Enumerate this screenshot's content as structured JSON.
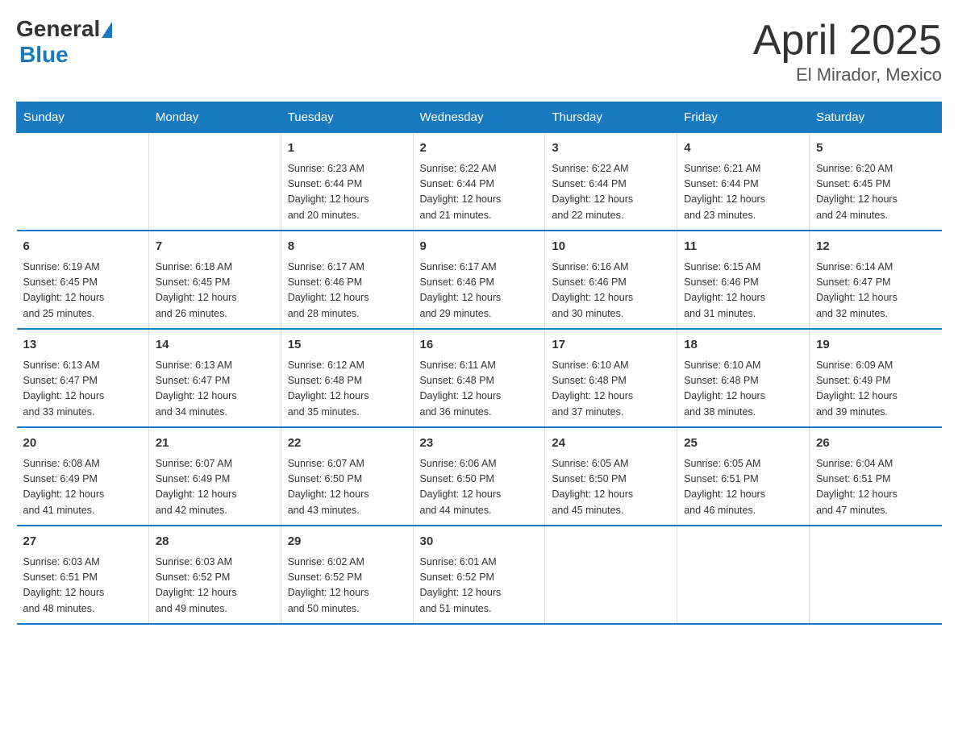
{
  "logo": {
    "general": "General",
    "blue": "Blue"
  },
  "title": "April 2025",
  "subtitle": "El Mirador, Mexico",
  "days_header": [
    "Sunday",
    "Monday",
    "Tuesday",
    "Wednesday",
    "Thursday",
    "Friday",
    "Saturday"
  ],
  "weeks": [
    [
      {
        "day": "",
        "info": ""
      },
      {
        "day": "",
        "info": ""
      },
      {
        "day": "1",
        "info": "Sunrise: 6:23 AM\nSunset: 6:44 PM\nDaylight: 12 hours\nand 20 minutes."
      },
      {
        "day": "2",
        "info": "Sunrise: 6:22 AM\nSunset: 6:44 PM\nDaylight: 12 hours\nand 21 minutes."
      },
      {
        "day": "3",
        "info": "Sunrise: 6:22 AM\nSunset: 6:44 PM\nDaylight: 12 hours\nand 22 minutes."
      },
      {
        "day": "4",
        "info": "Sunrise: 6:21 AM\nSunset: 6:44 PM\nDaylight: 12 hours\nand 23 minutes."
      },
      {
        "day": "5",
        "info": "Sunrise: 6:20 AM\nSunset: 6:45 PM\nDaylight: 12 hours\nand 24 minutes."
      }
    ],
    [
      {
        "day": "6",
        "info": "Sunrise: 6:19 AM\nSunset: 6:45 PM\nDaylight: 12 hours\nand 25 minutes."
      },
      {
        "day": "7",
        "info": "Sunrise: 6:18 AM\nSunset: 6:45 PM\nDaylight: 12 hours\nand 26 minutes."
      },
      {
        "day": "8",
        "info": "Sunrise: 6:17 AM\nSunset: 6:46 PM\nDaylight: 12 hours\nand 28 minutes."
      },
      {
        "day": "9",
        "info": "Sunrise: 6:17 AM\nSunset: 6:46 PM\nDaylight: 12 hours\nand 29 minutes."
      },
      {
        "day": "10",
        "info": "Sunrise: 6:16 AM\nSunset: 6:46 PM\nDaylight: 12 hours\nand 30 minutes."
      },
      {
        "day": "11",
        "info": "Sunrise: 6:15 AM\nSunset: 6:46 PM\nDaylight: 12 hours\nand 31 minutes."
      },
      {
        "day": "12",
        "info": "Sunrise: 6:14 AM\nSunset: 6:47 PM\nDaylight: 12 hours\nand 32 minutes."
      }
    ],
    [
      {
        "day": "13",
        "info": "Sunrise: 6:13 AM\nSunset: 6:47 PM\nDaylight: 12 hours\nand 33 minutes."
      },
      {
        "day": "14",
        "info": "Sunrise: 6:13 AM\nSunset: 6:47 PM\nDaylight: 12 hours\nand 34 minutes."
      },
      {
        "day": "15",
        "info": "Sunrise: 6:12 AM\nSunset: 6:48 PM\nDaylight: 12 hours\nand 35 minutes."
      },
      {
        "day": "16",
        "info": "Sunrise: 6:11 AM\nSunset: 6:48 PM\nDaylight: 12 hours\nand 36 minutes."
      },
      {
        "day": "17",
        "info": "Sunrise: 6:10 AM\nSunset: 6:48 PM\nDaylight: 12 hours\nand 37 minutes."
      },
      {
        "day": "18",
        "info": "Sunrise: 6:10 AM\nSunset: 6:48 PM\nDaylight: 12 hours\nand 38 minutes."
      },
      {
        "day": "19",
        "info": "Sunrise: 6:09 AM\nSunset: 6:49 PM\nDaylight: 12 hours\nand 39 minutes."
      }
    ],
    [
      {
        "day": "20",
        "info": "Sunrise: 6:08 AM\nSunset: 6:49 PM\nDaylight: 12 hours\nand 41 minutes."
      },
      {
        "day": "21",
        "info": "Sunrise: 6:07 AM\nSunset: 6:49 PM\nDaylight: 12 hours\nand 42 minutes."
      },
      {
        "day": "22",
        "info": "Sunrise: 6:07 AM\nSunset: 6:50 PM\nDaylight: 12 hours\nand 43 minutes."
      },
      {
        "day": "23",
        "info": "Sunrise: 6:06 AM\nSunset: 6:50 PM\nDaylight: 12 hours\nand 44 minutes."
      },
      {
        "day": "24",
        "info": "Sunrise: 6:05 AM\nSunset: 6:50 PM\nDaylight: 12 hours\nand 45 minutes."
      },
      {
        "day": "25",
        "info": "Sunrise: 6:05 AM\nSunset: 6:51 PM\nDaylight: 12 hours\nand 46 minutes."
      },
      {
        "day": "26",
        "info": "Sunrise: 6:04 AM\nSunset: 6:51 PM\nDaylight: 12 hours\nand 47 minutes."
      }
    ],
    [
      {
        "day": "27",
        "info": "Sunrise: 6:03 AM\nSunset: 6:51 PM\nDaylight: 12 hours\nand 48 minutes."
      },
      {
        "day": "28",
        "info": "Sunrise: 6:03 AM\nSunset: 6:52 PM\nDaylight: 12 hours\nand 49 minutes."
      },
      {
        "day": "29",
        "info": "Sunrise: 6:02 AM\nSunset: 6:52 PM\nDaylight: 12 hours\nand 50 minutes."
      },
      {
        "day": "30",
        "info": "Sunrise: 6:01 AM\nSunset: 6:52 PM\nDaylight: 12 hours\nand 51 minutes."
      },
      {
        "day": "",
        "info": ""
      },
      {
        "day": "",
        "info": ""
      },
      {
        "day": "",
        "info": ""
      }
    ]
  ]
}
